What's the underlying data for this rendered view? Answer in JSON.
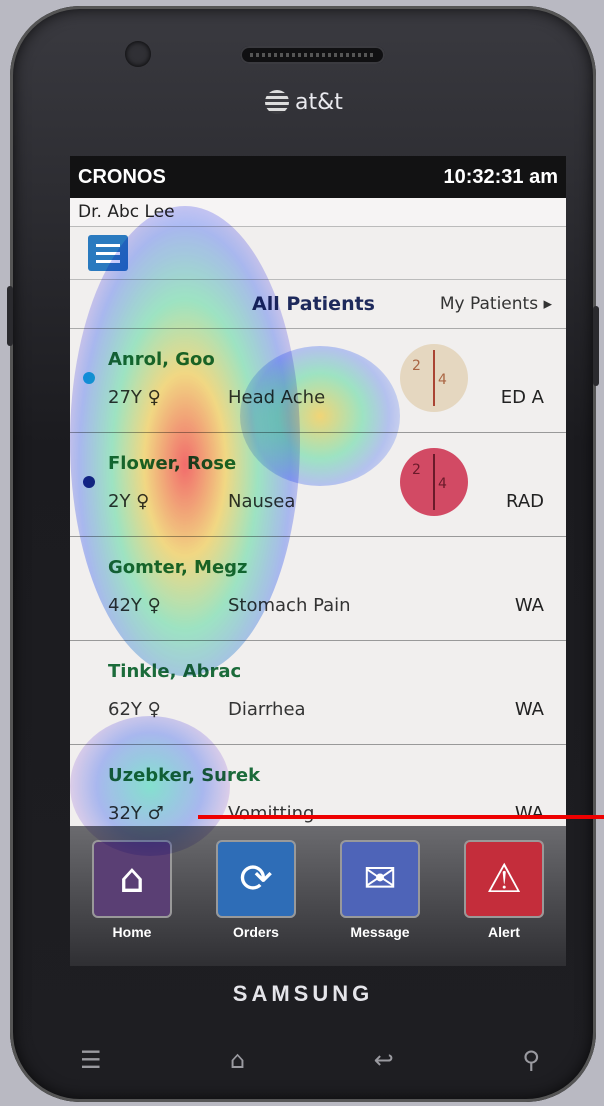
{
  "device": {
    "carrier": "at&t",
    "manufacturer": "SAMSUNG"
  },
  "status_bar": {
    "app_name": "CRONOS",
    "time": "10:32:31 am"
  },
  "doctor_name": "Dr. Abc Lee",
  "tabs": {
    "all": "All Patients",
    "mine": "My Patients"
  },
  "patients": [
    {
      "name": "Anrol, Goo",
      "age_sex": "27Y ♀",
      "complaint": "Head Ache",
      "location": "ED A",
      "badge_left": "2",
      "badge_right": "4"
    },
    {
      "name": "Flower, Rose",
      "age_sex": "2Y ♀",
      "complaint": "Nausea",
      "location": "RAD",
      "badge_left": "2",
      "badge_right": "4"
    },
    {
      "name": "Gomter, Megz",
      "age_sex": "42Y ♀",
      "complaint": "Stomach Pain",
      "location": "WA"
    },
    {
      "name": "Tinkle, Abrac",
      "age_sex": "62Y ♀",
      "complaint": "Diarrhea",
      "location": "WA"
    },
    {
      "name": "Uzebker, Surek",
      "age_sex": "32Y ♂",
      "complaint": "Vomitting",
      "location": "WA"
    }
  ],
  "nav": [
    {
      "label": "Home",
      "icon": "home-icon",
      "color": "#5a3f74"
    },
    {
      "label": "Orders",
      "icon": "refresh-icon",
      "color": "#2e6db7"
    },
    {
      "label": "Message",
      "icon": "envelope-icon",
      "color": "#4e64b8"
    },
    {
      "label": "Alert",
      "icon": "warning-icon",
      "color": "#c42d3b"
    }
  ],
  "colors": {
    "accent_blue": "#2a7abf",
    "name_green": "#1b6b3a",
    "dot_cyan": "#19b5d8",
    "dot_navy": "#1a2b8a"
  }
}
